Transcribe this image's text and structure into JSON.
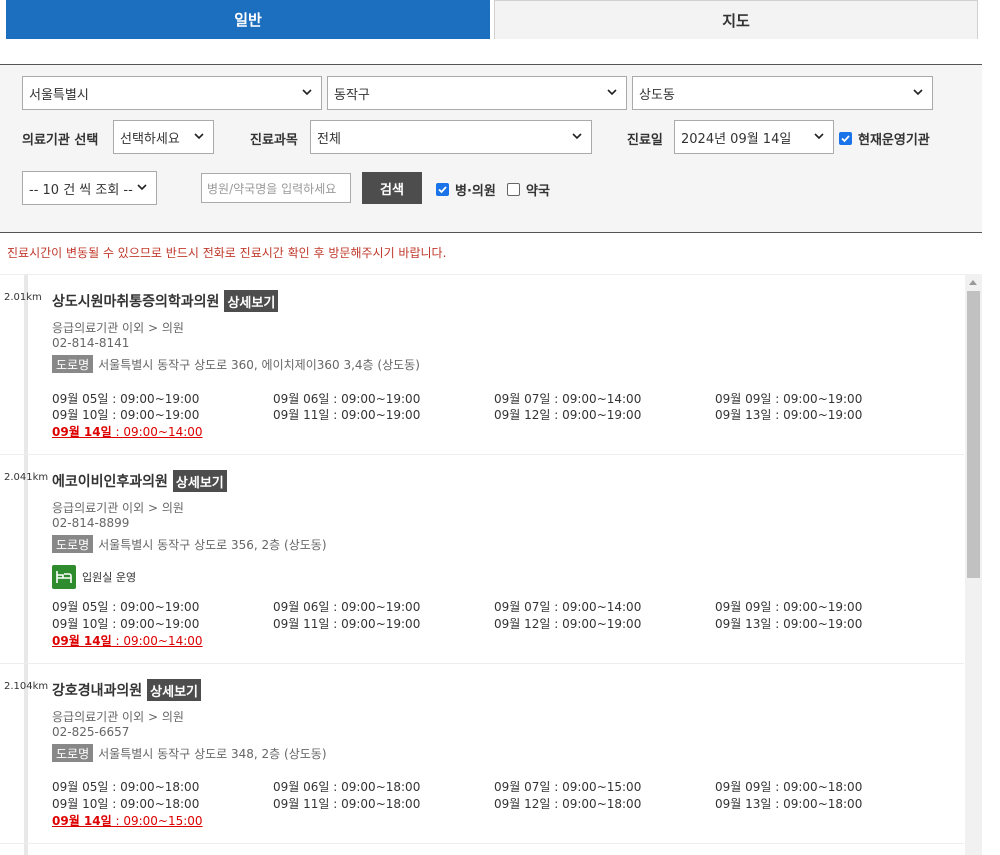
{
  "tabs": [
    {
      "label": "일반",
      "active": true
    },
    {
      "label": "지도",
      "active": false
    }
  ],
  "filters": {
    "city": "서울특별시",
    "district": "동작구",
    "dong": "상도동",
    "institution_label": "의료기관 선택",
    "institution_value": "선택하세요",
    "department_label": "진료과목",
    "department_value": "전체",
    "date_label": "진료일",
    "date_value": "2024년 09월 14일",
    "open_now_label": "현재운영기관",
    "open_now_checked": true,
    "page_size": "-- 10 건 씩 조회 --",
    "search_placeholder": "병원/약국명을 입력하세요",
    "search_button": "검색",
    "clinic_label": "병·의원",
    "clinic_checked": true,
    "pharmacy_label": "약국",
    "pharmacy_checked": false
  },
  "notice": "진료시간이 변동될 수 있으므로 반드시 전화로 진료시간 확인 후 방문해주시기 바랍니다.",
  "detail_label": "상세보기",
  "road_label": "도로명",
  "colors": {
    "tab_active": "#1c6fbf",
    "notice": "#c0392b",
    "today": "#dd0000",
    "bed_icon": "#2e8b2e"
  },
  "results": [
    {
      "distance": "2.01km",
      "name": "상도시원마취통증의학과의원",
      "category": "응급의료기관 이외 > 의원",
      "phone": "02-814-8141",
      "address": "서울특별시 동작구 상도로 360, 에이치제이360 3,4층 (상도동)",
      "tag": "",
      "schedule": [
        [
          "09월 05일 : 09:00~19:00",
          "09월 06일 : 09:00~19:00",
          "09월 07일 : 09:00~14:00",
          "09월 09일 : 09:00~19:00"
        ],
        [
          "09월 10일 : 09:00~19:00",
          "09월 11일 : 09:00~19:00",
          "09월 12일 : 09:00~19:00",
          "09월 13일 : 09:00~19:00"
        ]
      ],
      "today_date": "09월 14일",
      "today_hours": " : 09:00~14:00"
    },
    {
      "distance": "2.041km",
      "name": "에코이비인후과의원",
      "category": "응급의료기관 이외 > 의원",
      "phone": "02-814-8899",
      "address": "서울특별시 동작구 상도로 356, 2층 (상도동)",
      "tag": "입원실 운영",
      "schedule": [
        [
          "09월 05일 : 09:00~19:00",
          "09월 06일 : 09:00~19:00",
          "09월 07일 : 09:00~14:00",
          "09월 09일 : 09:00~19:00"
        ],
        [
          "09월 10일 : 09:00~19:00",
          "09월 11일 : 09:00~19:00",
          "09월 12일 : 09:00~19:00",
          "09월 13일 : 09:00~19:00"
        ]
      ],
      "today_date": "09월 14일",
      "today_hours": " : 09:00~14:00"
    },
    {
      "distance": "2.104km",
      "name": "강호경내과의원",
      "category": "응급의료기관 이외 > 의원",
      "phone": "02-825-6657",
      "address": "서울특별시 동작구 상도로 348, 2층 (상도동)",
      "tag": "",
      "schedule": [
        [
          "09월 05일 : 09:00~18:00",
          "09월 06일 : 09:00~18:00",
          "09월 07일 : 09:00~15:00",
          "09월 09일 : 09:00~18:00"
        ],
        [
          "09월 10일 : 09:00~18:00",
          "09월 11일 : 09:00~18:00",
          "09월 12일 : 09:00~18:00",
          "09월 13일 : 09:00~18:00"
        ]
      ],
      "today_date": "09월 14일",
      "today_hours": " : 09:00~15:00"
    }
  ]
}
